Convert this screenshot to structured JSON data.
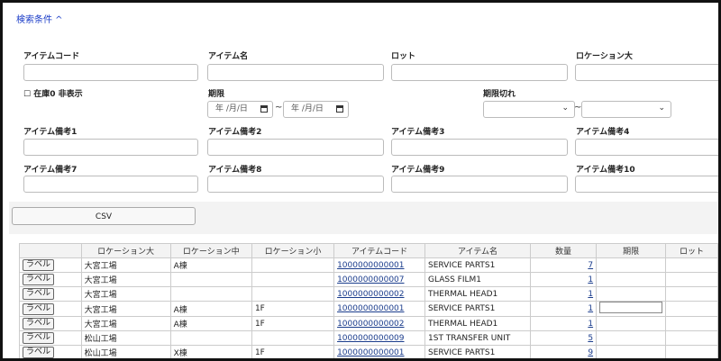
{
  "search_toggle": "検索条件 ^",
  "fields": {
    "item_code": "アイテムコード",
    "item_name": "アイテム名",
    "lot": "ロット",
    "location_large": "ロケーション大",
    "stock_zero_hide": "在庫0 非表示",
    "period": "期限",
    "expired": "期限切れ",
    "date_placeholder": "年 /月/日",
    "tilde": "~",
    "note1": "アイテム備考1",
    "note2": "アイテム備考2",
    "note3": "アイテム備考3",
    "note4": "アイテム備考4",
    "note7": "アイテム備考7",
    "note8": "アイテム備考8",
    "note9": "アイテム備考9",
    "note10": "アイテム備考10"
  },
  "csv_button": "CSV",
  "table": {
    "headers": [
      "",
      "ロケーション大",
      "ロケーション中",
      "ロケーション小",
      "アイテムコード",
      "アイテム名",
      "数量",
      "期限",
      "ロット"
    ],
    "label_button": "ラベル",
    "rows": [
      {
        "loc_l": "大宮工場",
        "loc_m": "A棟",
        "loc_s": "",
        "code": "1000000000001",
        "name": "SERVICE PARTS1",
        "qty": "7"
      },
      {
        "loc_l": "大宮工場",
        "loc_m": "",
        "loc_s": "",
        "code": "1000000000007",
        "name": "GLASS FILM1",
        "qty": "1"
      },
      {
        "loc_l": "大宮工場",
        "loc_m": "",
        "loc_s": "",
        "code": "1000000000002",
        "name": "THERMAL HEAD1",
        "qty": "1"
      },
      {
        "loc_l": "大宮工場",
        "loc_m": "A棟",
        "loc_s": "1F",
        "code": "1000000000001",
        "name": "SERVICE PARTS1",
        "qty": "1"
      },
      {
        "loc_l": "大宮工場",
        "loc_m": "A棟",
        "loc_s": "1F",
        "code": "1000000000002",
        "name": "THERMAL HEAD1",
        "qty": "1"
      },
      {
        "loc_l": "松山工場",
        "loc_m": "",
        "loc_s": "",
        "code": "1000000000009",
        "name": "1ST TRANSFER UNIT",
        "qty": "5"
      },
      {
        "loc_l": "松山工場",
        "loc_m": "X棟",
        "loc_s": "1F",
        "code": "1000000000001",
        "name": "SERVICE PARTS1",
        "qty": "9"
      }
    ]
  }
}
